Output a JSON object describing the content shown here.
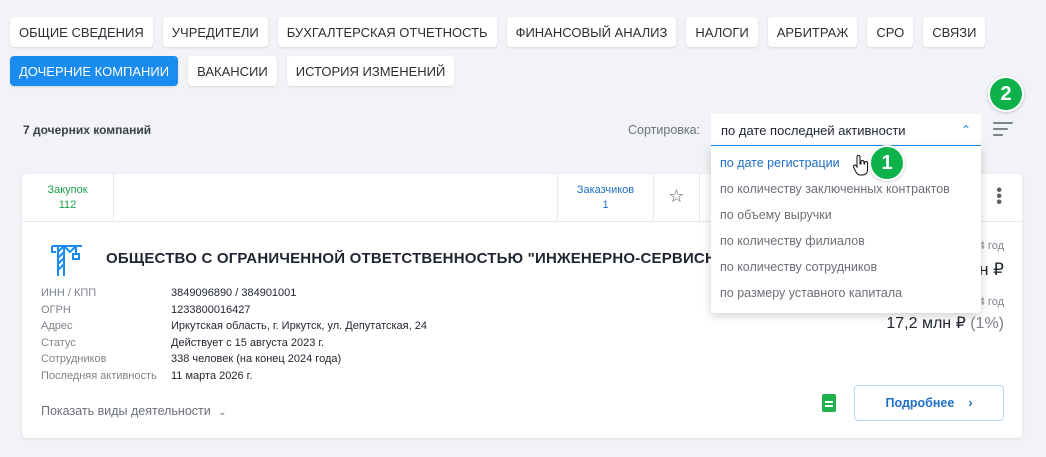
{
  "tabs_row1": [
    "ОБЩИЕ СВЕДЕНИЯ",
    "УЧРЕДИТЕЛИ",
    "БУХГАЛТЕРСКАЯ ОТЧЕТНОСТЬ",
    "ФИНАНСОВЫЙ АНАЛИЗ",
    "НАЛОГИ",
    "АРБИТРАЖ",
    "СРО",
    "СВЯЗИ"
  ],
  "tabs_row2": [
    "ДОЧЕРНИЕ КОМПАНИИ",
    "ВАКАНСИИ",
    "ИСТОРИЯ ИЗМЕНЕНИЙ"
  ],
  "active_tab": "ДОЧЕРНИЕ КОМПАНИИ",
  "subsidiaries_count": "7 дочерних компаний",
  "sort": {
    "label": "Сортировка:",
    "selected": "по дате последней активности",
    "options": [
      "по дате регистрации",
      "по количеству заключенных контрактов",
      "по объему выручки",
      "по количеству филиалов",
      "по количеству сотрудников",
      "по размеру уставного капитала"
    ],
    "hovered_index": 0
  },
  "badges": {
    "one": "1",
    "two": "2"
  },
  "card": {
    "stats": {
      "zakupok_label": "Закупок",
      "zakupok_value": "112",
      "zakazchikov_label": "Заказчиков",
      "zakazchikov_value": "1"
    },
    "company_name": "ОБЩЕСТВО С ОГРАНИЧЕННОЙ ОТВЕТСТВЕННОСТЬЮ \"ИНЖЕНЕРНО-СЕРВИСНАЯ КОМПАНИЯ\"",
    "details": [
      {
        "key": "ИНН / КПП",
        "value": "3849096890 / 384901001"
      },
      {
        "key": "ОГРН",
        "value": "1233800016427"
      },
      {
        "key": "Адрес",
        "value": "Иркутская область, г. Иркутск, ул. Депутатская, 24"
      },
      {
        "key": "Статус",
        "value": "Действует с 15 августа 2023 г."
      },
      {
        "key": "Сотрудников",
        "value": "338 человек (на конец 2024 года)"
      },
      {
        "key": "Последняя активность",
        "value": "11 марта 2026 г."
      }
    ],
    "year1": "4 год",
    "rev1": "н ₽",
    "year2": "4 год",
    "rev2_value": "17,2 млн ₽",
    "rev2_pct": "(1%)",
    "show_kinds": "Показать виды деятельности",
    "more_button": "Подробнее"
  },
  "colors": {
    "accent": "#1a8cf0",
    "badge": "#0db34a",
    "procure": "#1aa34a"
  }
}
